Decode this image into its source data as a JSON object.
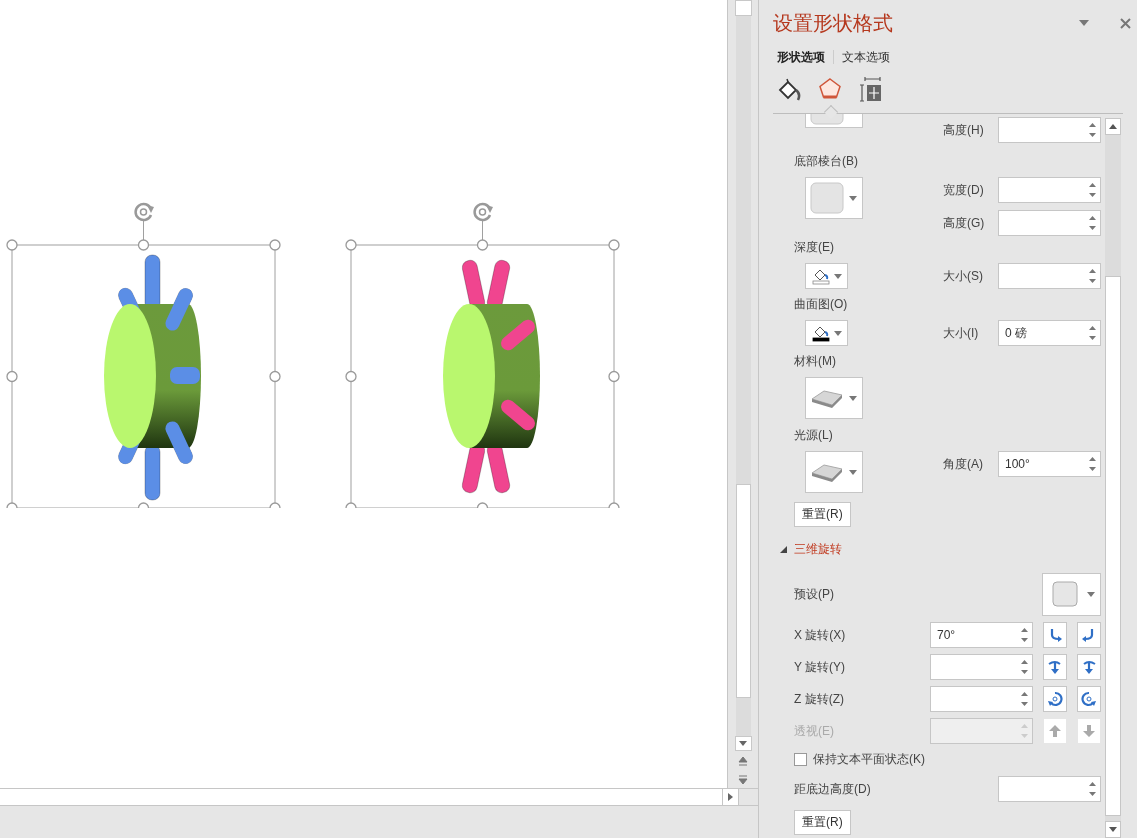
{
  "canvas": {
    "shapes": [
      {
        "kind": "straight",
        "color": "#5b8ee6",
        "selected": true
      },
      {
        "kind": "splayed",
        "color": "#f0458f",
        "selected": true
      }
    ]
  },
  "panel": {
    "title": "设置形状格式",
    "tabs": [
      {
        "label": "形状选项",
        "selected": true
      },
      {
        "label": "文本选项",
        "selected": false
      }
    ],
    "icon_tabs": [
      {
        "kind": "fill",
        "selected": false
      },
      {
        "kind": "effects",
        "selected": true
      },
      {
        "kind": "size",
        "selected": false
      }
    ],
    "rows": [
      {
        "kind": "preview-top",
        "dropdown": {
          "kind": "bevel"
        },
        "fields": [
          {
            "label": "高度(H)"
          }
        ]
      },
      {
        "kind": "label",
        "label": "底部棱台(B)"
      },
      {
        "kind": "preview",
        "dropdown": {
          "kind": "bevel"
        },
        "fields": [
          {
            "label": "宽度(D)"
          },
          {
            "label": "高度(G)"
          }
        ]
      },
      {
        "kind": "label",
        "label": "深度(E)"
      },
      {
        "kind": "color",
        "dropdown": {
          "kind": "depth"
        },
        "fields": [
          {
            "label": "大小(S)"
          }
        ]
      },
      {
        "kind": "label",
        "label": "曲面图(O)"
      },
      {
        "kind": "color",
        "dropdown": {
          "kind": "contour"
        },
        "fields": [
          {
            "label": "大小(I)",
            "value": "0 磅"
          }
        ]
      },
      {
        "kind": "label",
        "label": "材料(M)"
      },
      {
        "kind": "preview",
        "dropdown": {
          "kind": "material"
        },
        "fields": []
      },
      {
        "kind": "label",
        "label": "光源(L)"
      },
      {
        "kind": "preview",
        "dropdown": {
          "kind": "light"
        },
        "fields": [
          {
            "label": "角度(A)",
            "value": "100°"
          }
        ]
      },
      {
        "kind": "button",
        "label": "重置(R)"
      }
    ],
    "rotation": {
      "title": "三维旋转",
      "expanded": true,
      "preset_label": "预设(P)",
      "axes": [
        {
          "kind": "x",
          "label": "X 旋转(X)",
          "value": "70°",
          "disabled": false
        },
        {
          "kind": "y",
          "label": "Y 旋转(Y)",
          "disabled": false
        },
        {
          "kind": "z",
          "label": "Z 旋转(Z)",
          "disabled": false
        },
        {
          "kind": "perspective",
          "label": "透视(E)",
          "disabled": true
        }
      ],
      "keep_flat": {
        "label": "保持文本平面状态(K)",
        "checked": false
      },
      "distance": {
        "label": "距底边高度(D)"
      },
      "reset": "重置(R)"
    }
  }
}
